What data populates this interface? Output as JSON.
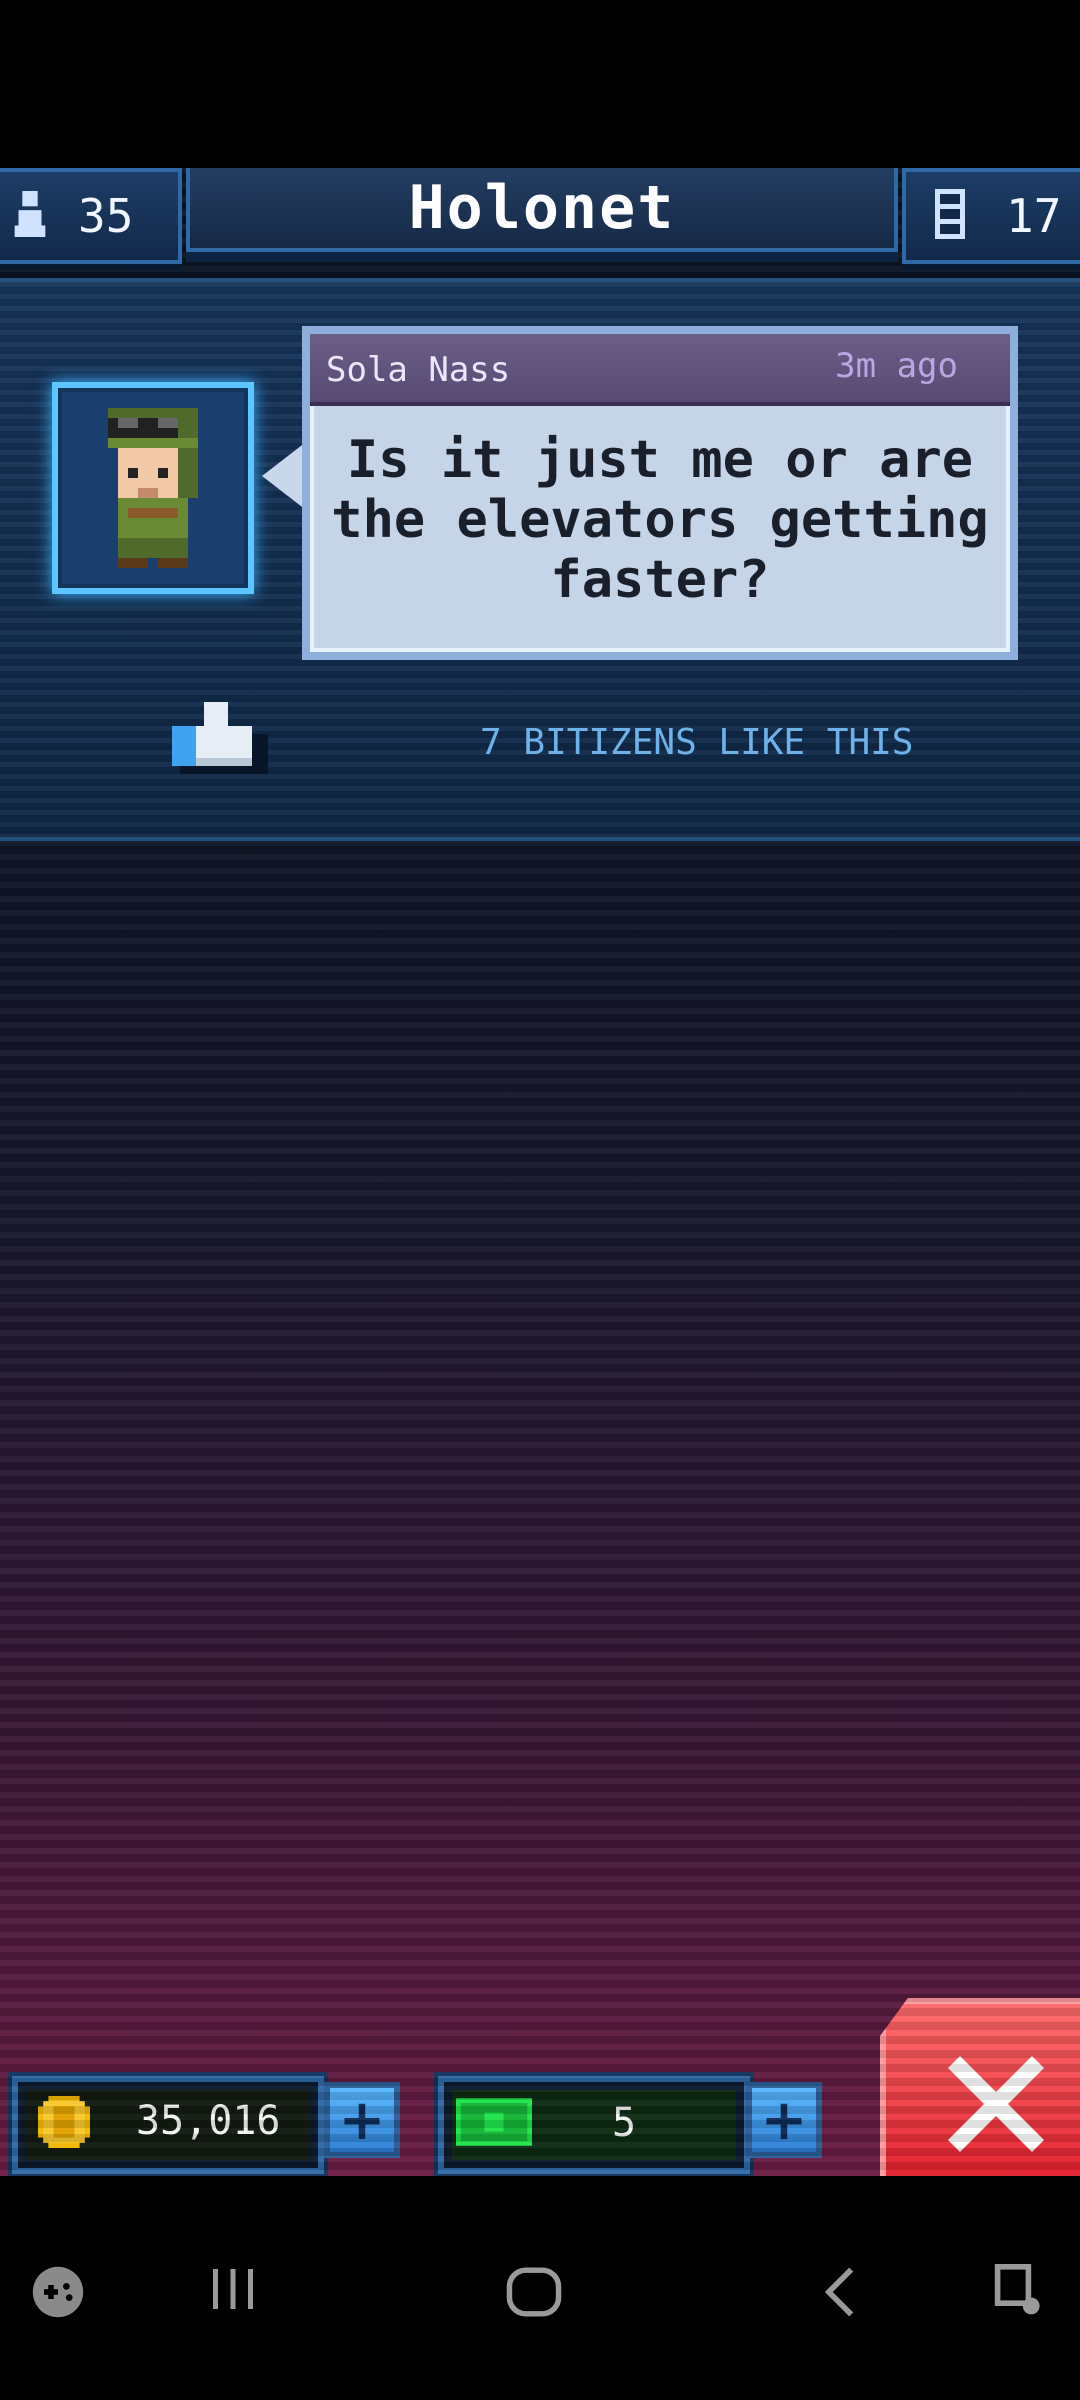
{
  "header": {
    "population": "35",
    "title": "Holonet",
    "floors": "17"
  },
  "post": {
    "author": "Sola Nass",
    "time_ago": "3m ago",
    "message": "Is it just me or are the elevators getting faster?",
    "likes_text": "7 BITIZENS LIKE THIS"
  },
  "currency": {
    "coins": "35,016",
    "bux": "5"
  },
  "icons": {
    "population": "person-icon",
    "floors": "elevator-icon",
    "like": "thumbs-up-icon",
    "coin": "coin-icon",
    "bux": "bux-icon",
    "plus": "plus-icon",
    "close": "close-icon",
    "nav_game": "gamepad-icon",
    "nav_recent": "recent-apps-icon",
    "nav_home": "home-icon",
    "nav_back": "back-icon",
    "nav_assist": "screen-assist-icon"
  },
  "colors": {
    "accent_blue": "#2f6aa6",
    "bubble": "#c6d4e8",
    "likes_text": "#6fb2ea",
    "close_red": "#e21c2a"
  }
}
